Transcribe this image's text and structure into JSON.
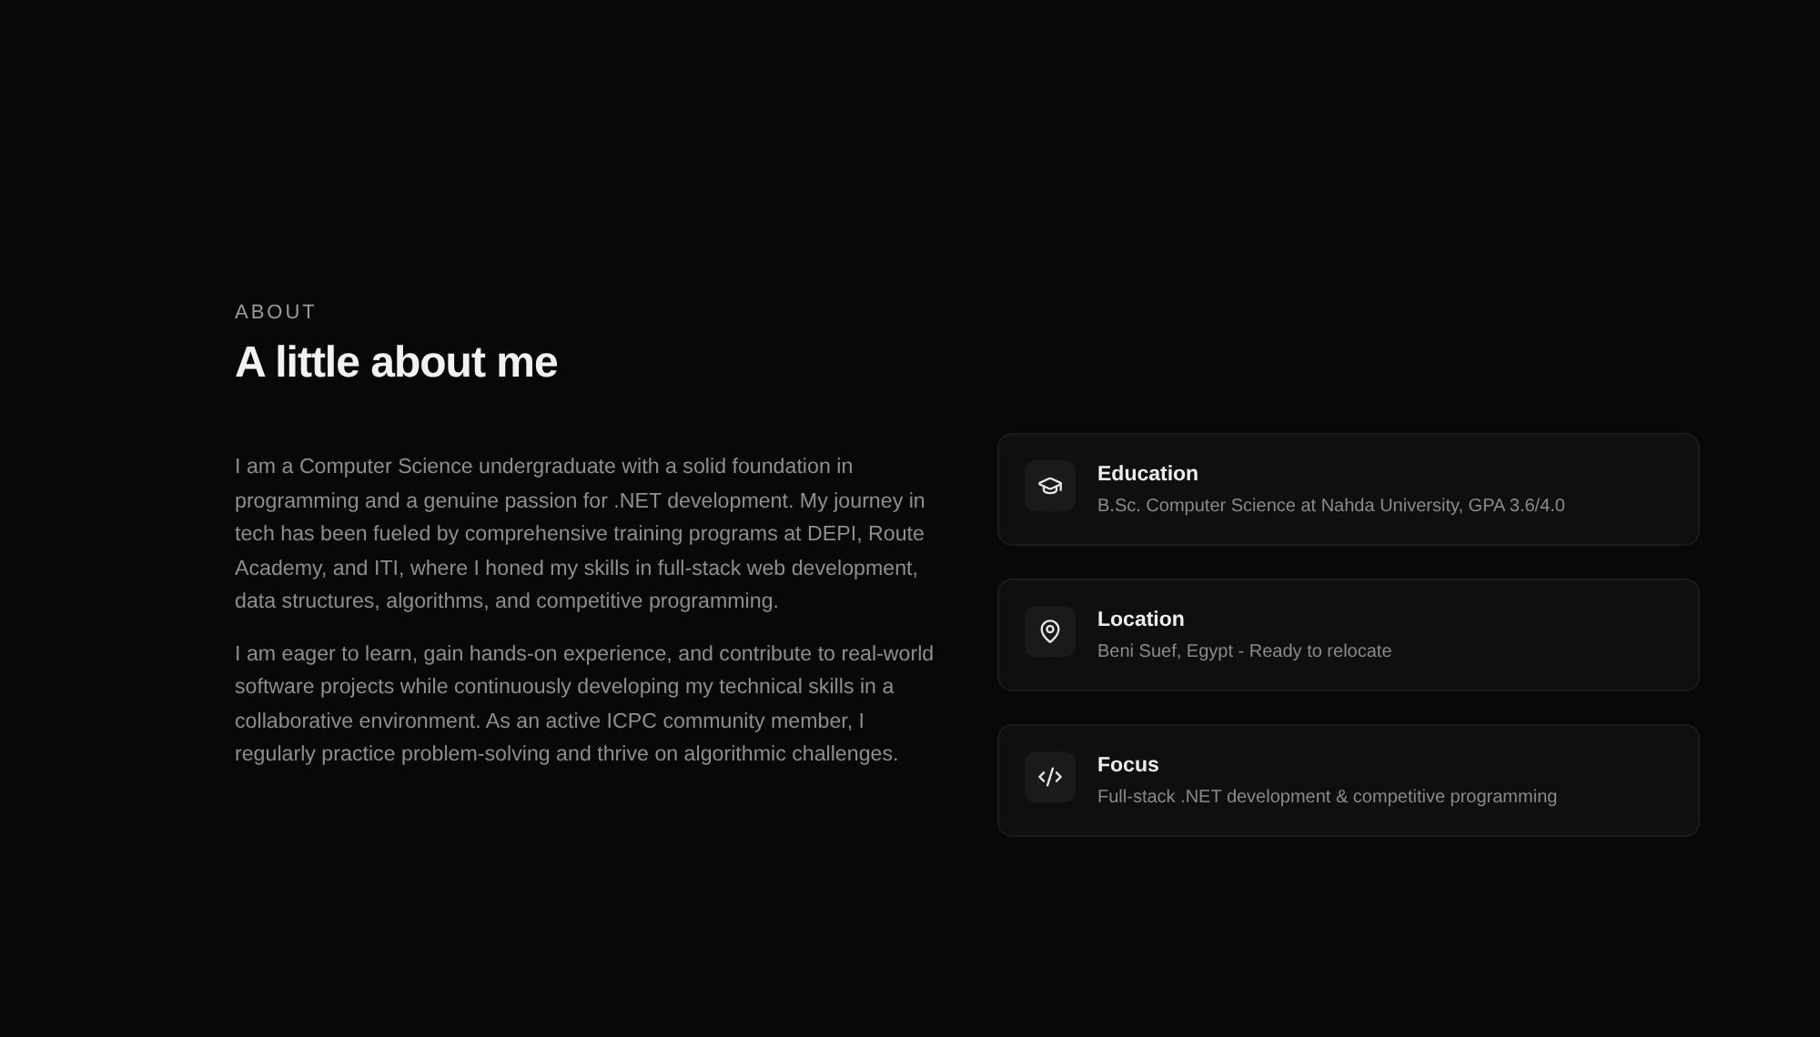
{
  "section": {
    "eyebrow": "ABOUT",
    "title": "A little about me"
  },
  "paragraphs": [
    "I am a Computer Science undergraduate with a solid foundation in programming and a genuine passion for .NET development. My journey in tech has been fueled by comprehensive training programs at DEPI, Route Academy, and ITI, where I honed my skills in full-stack web development, data structures, algorithms, and competitive programming.",
    "I am eager to learn, gain hands-on experience, and contribute to real-world software projects while continuously developing my technical skills in a collaborative environment. As an active ICPC community member, I regularly practice problem-solving and thrive on algorithmic challenges."
  ],
  "cards": [
    {
      "kind": "education",
      "title": "Education",
      "text": "B.Sc. Computer Science at Nahda University, GPA 3.6/4.0"
    },
    {
      "kind": "location",
      "title": "Location",
      "text": "Beni Suef, Egypt - Ready to relocate"
    },
    {
      "kind": "code",
      "title": "Focus",
      "text": "Full-stack .NET development & competitive programming"
    }
  ]
}
